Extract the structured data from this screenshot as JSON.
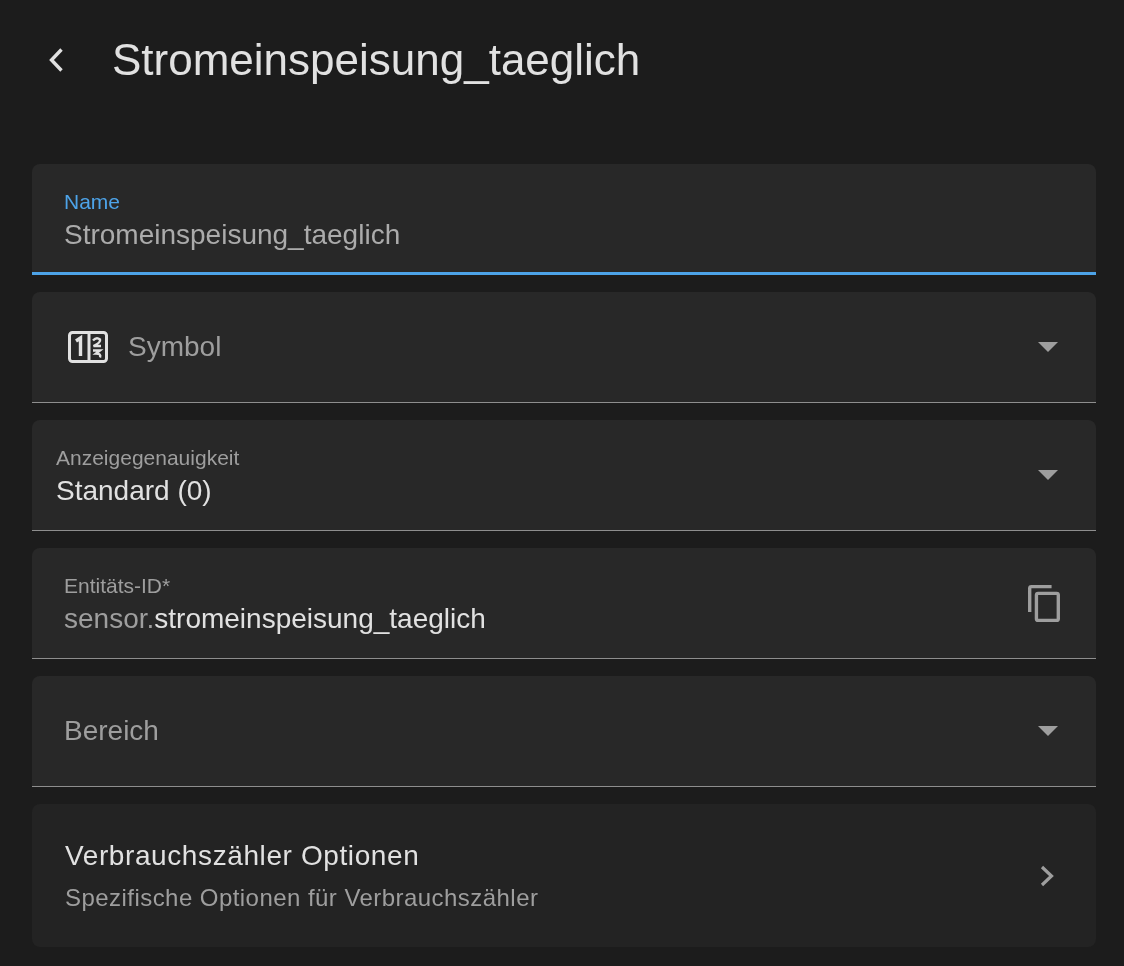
{
  "header": {
    "title": "Stromeinspeisung_taeglich"
  },
  "fields": [
    {
      "kind": "text",
      "label": "Name",
      "placeholder": "Stromeinspeisung_taeglich",
      "focused": true
    },
    {
      "kind": "icon_picker",
      "label": "Symbol",
      "focused": false
    },
    {
      "kind": "select",
      "label": "Anzeigegenauigkeit",
      "value": "Standard (0)",
      "focused": false
    },
    {
      "kind": "entity_id",
      "label": "Entitäts-ID*",
      "prefix": "sensor.",
      "value": "stromeinspeisung_taeglich",
      "focused": false
    },
    {
      "kind": "picker",
      "label": "Bereich",
      "focused": false
    }
  ],
  "section": {
    "title": "Verbrauchszähler Optionen",
    "subtitle": "Spezifische Optionen für Verbrauchszähler"
  }
}
